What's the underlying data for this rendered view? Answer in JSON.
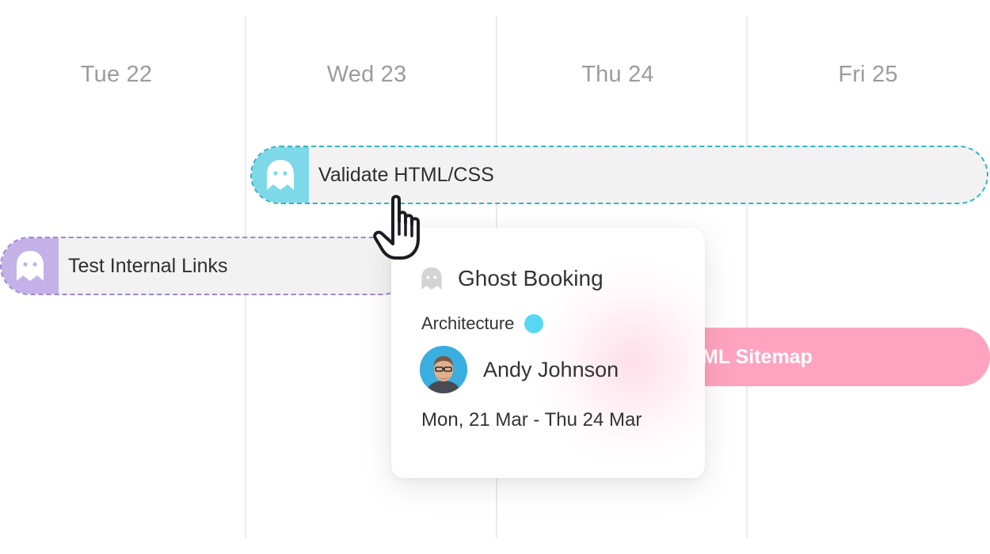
{
  "calendar": {
    "days": [
      {
        "label": "Tue 22"
      },
      {
        "label": "Wed 23"
      },
      {
        "label": "Thu 24"
      },
      {
        "label": "Fri 25"
      }
    ]
  },
  "tasks": {
    "validate": {
      "label": "Validate HTML/CSS",
      "accent": "#2fb4c8",
      "icon": "ghost-icon"
    },
    "links": {
      "label": "Test Internal Links",
      "accent": "#9d86d6",
      "icon": "ghost-icon"
    },
    "sitemap": {
      "label": "ML Sitemap",
      "color": "#ffa3c0"
    }
  },
  "popup": {
    "title": "Ghost Booking",
    "title_icon": "ghost-icon",
    "category": "Architecture",
    "category_color": "#57d8f2",
    "assignee": "Andy Johnson",
    "dates": "Mon, 21 Mar - Thu 24 Mar"
  },
  "cursor": {
    "icon": "hand-pointer-icon"
  }
}
